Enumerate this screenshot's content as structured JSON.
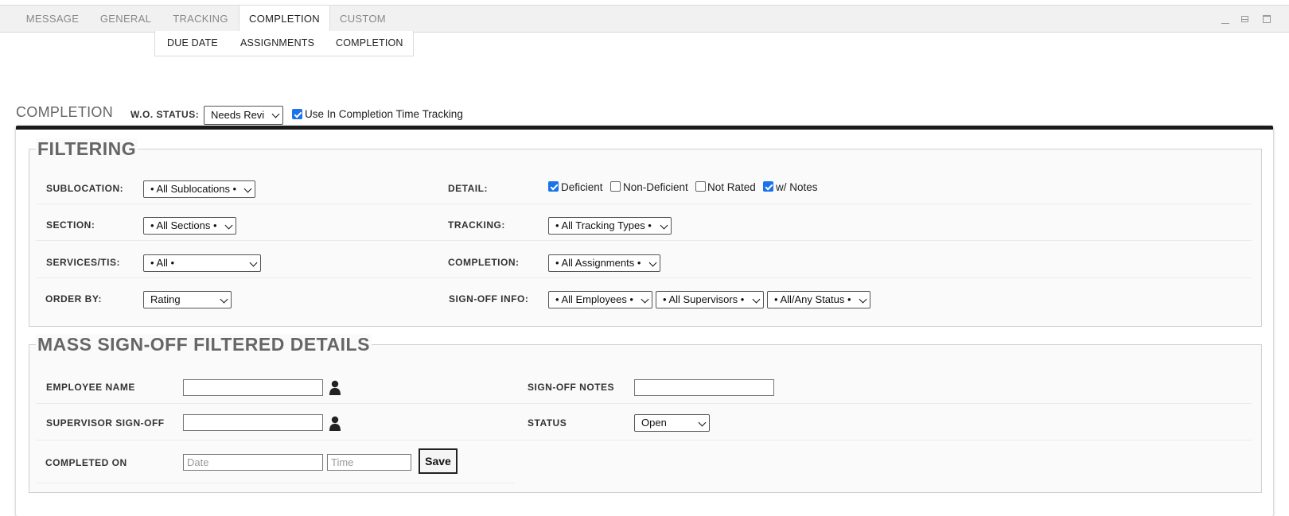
{
  "tabs": [
    "MESSAGE",
    "GENERAL",
    "TRACKING",
    "COMPLETION",
    "CUSTOM"
  ],
  "active_tab": "COMPLETION",
  "window_controls": [
    "minimize-icon",
    "restore-icon",
    "maximize-icon"
  ],
  "subtabs": [
    "DUE DATE",
    "ASSIGNMENTS",
    "COMPLETION"
  ],
  "completion": {
    "title": "COMPLETION",
    "wo_status_label": "W.O. STATUS:",
    "wo_status_value": "Needs Revi",
    "use_tracking_label": "Use In Completion Time Tracking",
    "use_tracking_checked": true
  },
  "filtering": {
    "legend": "FILTERING",
    "sublocation_label": "SUBLOCATION:",
    "sublocation_value": "• All Sublocations •",
    "section_label": "SECTION:",
    "section_value": "• All Sections •",
    "services_label": "SERVICES/TIS:",
    "services_value": "• All •",
    "order_label": "ORDER BY:",
    "order_value": "Rating",
    "detail_label": "DETAIL:",
    "detail_options": [
      {
        "label": "Deficient",
        "checked": true
      },
      {
        "label": "Non-Deficient",
        "checked": false
      },
      {
        "label": "Not Rated",
        "checked": false
      },
      {
        "label": "w/ Notes",
        "checked": true
      }
    ],
    "tracking_label": "TRACKING:",
    "tracking_value": "• All Tracking Types •",
    "completion_label": "COMPLETION:",
    "completion_value": "• All Assignments •",
    "signoff_label": "SIGN-OFF INFO:",
    "signoff_employees": "• All Employees •",
    "signoff_supervisors": "• All Supervisors •",
    "signoff_status": "• All/Any Status •"
  },
  "mass": {
    "legend": "MASS SIGN-OFF FILTERED DETAILS",
    "employee_label": "EMPLOYEE NAME",
    "employee_value": "",
    "supervisor_label": "SUPERVISOR SIGN-OFF",
    "supervisor_value": "",
    "completed_label": "COMPLETED ON",
    "date_placeholder": "Date",
    "time_placeholder": "Time",
    "save_label": "Save",
    "notes_label": "SIGN-OFF NOTES",
    "notes_value": "",
    "status_label": "STATUS",
    "status_value": "Open"
  },
  "colors": {
    "accent": "#1a73e8",
    "panel_border": "#1a1a1a"
  }
}
